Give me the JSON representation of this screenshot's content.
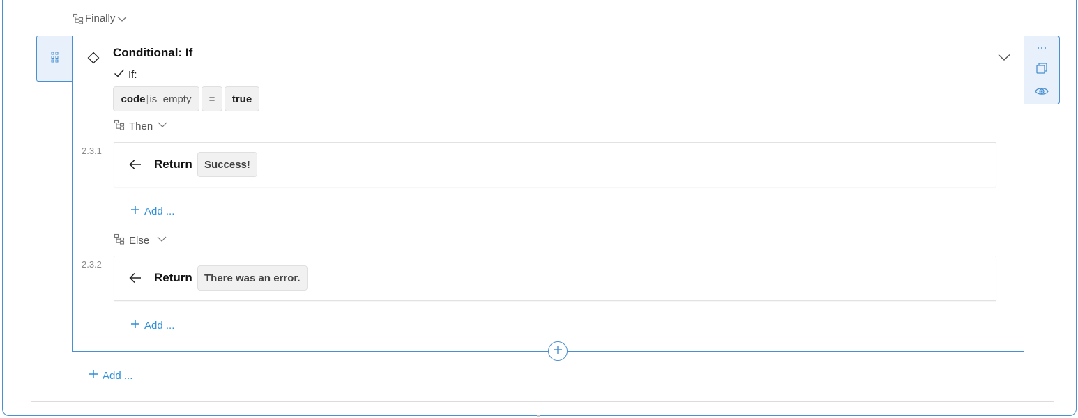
{
  "finally": {
    "label": "Finally"
  },
  "block": {
    "title": "Conditional: If",
    "if_label": "If:",
    "condition": {
      "variable": "code",
      "filter": "is_empty",
      "operator": "=",
      "value": "true"
    },
    "then": {
      "label": "Then",
      "step_number": "2.3.1",
      "keyword": "Return",
      "value": "Success!",
      "add_label": "Add ..."
    },
    "else": {
      "label": "Else",
      "step_number": "2.3.2",
      "keyword": "Return",
      "value": "There was an error.",
      "add_label": "Add ..."
    }
  },
  "toolbar": {
    "more_icon": "more-icon",
    "copy_icon": "copy-icon",
    "preview_icon": "eye-icon"
  },
  "footer": {
    "add_label": "Add ..."
  },
  "colors": {
    "accent": "#4a8fd0",
    "link": "#2f8fd8",
    "tab_bg": "#e8f1fb",
    "chip_bg": "#f1f1f1"
  }
}
